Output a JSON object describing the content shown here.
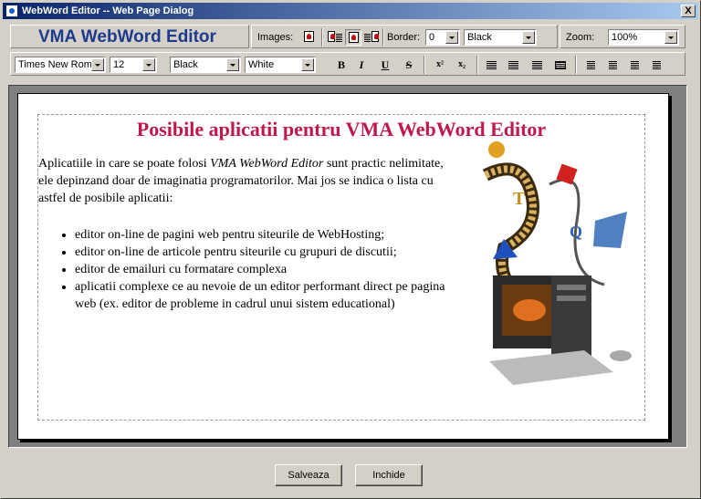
{
  "window": {
    "title": "WebWord Editor -- Web Page Dialog",
    "close_label": "X"
  },
  "toolbar1": {
    "brand": "VMA WebWord Editor",
    "images_label": "Images:",
    "border_label": "Border:",
    "border_value": "0",
    "border_color": "Black",
    "zoom_label": "Zoom:",
    "zoom_value": "100%"
  },
  "toolbar2": {
    "font_family": "Times New Roman",
    "font_size": "12",
    "fore_color": "Black",
    "back_color": "White",
    "bold": "B",
    "italic": "I",
    "underline": "U",
    "strike": "S",
    "superscript": "x²",
    "subscript": "x₂"
  },
  "document": {
    "heading": "Posibile aplicatii pentru VMA WebWord Editor",
    "intro_before": "Aplicatiile in care se poate folosi ",
    "intro_italic": "VMA WebWord Editor",
    "intro_after": " sunt practic nelimitate, ele depinzand doar de imaginatia programatorilor. Mai jos se indica o lista cu astfel de posibile aplicatii:",
    "items": [
      "editor on-line de pagini web pentru siteurile de WebHosting;",
      "editor on-line de articole pentru siteurile cu grupuri de discutii;",
      "editor de emailuri cu formatare complexa",
      "aplicatii complexe ce au nevoie de un editor performant direct pe pagina web (ex. editor de probleme in cadrul unui sistem educational)"
    ]
  },
  "footer": {
    "save_label": "Salveaza",
    "close_label": "Inchide"
  },
  "colors": {
    "heading": "#c0184a",
    "brand": "#1c3a8e",
    "titlebar_start": "#0a246a",
    "titlebar_end": "#a6caf0"
  }
}
